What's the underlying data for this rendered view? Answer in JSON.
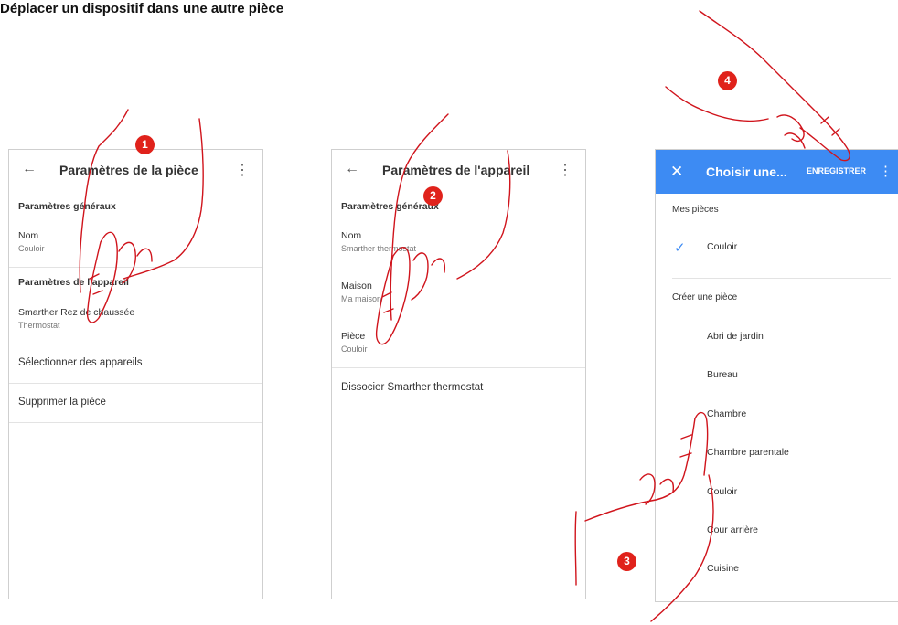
{
  "page": {
    "title": "Déplacer un dispositif dans une autre pièce"
  },
  "screen1": {
    "back_icon": "arrow-left-icon",
    "title": "Paramètres de la pièce",
    "general_section": "Paramètres généraux",
    "name_label": "Nom",
    "name_value": "Couloir",
    "device_section": "Paramètres de l'appareil",
    "device_name": "Smarther Rez de chaussée",
    "device_type": "Thermostat",
    "select_devices": "Sélectionner des appareils",
    "delete_room": "Supprimer la pièce"
  },
  "screen2": {
    "back_icon": "arrow-left-icon",
    "title": "Paramètres de l'appareil",
    "general_section": "Paramètres généraux",
    "name_label": "Nom",
    "name_value": "Smarther thermostat",
    "house_label": "Maison",
    "house_value": "Ma maison",
    "room_label": "Pièce",
    "room_value": "Couloir",
    "dissociate": "Dissocier Smarther thermostat"
  },
  "screen3": {
    "close_icon": "close-icon",
    "title": "Choisir une...",
    "save": "ENREGISTRER",
    "my_rooms": "Mes pièces",
    "selected_room": "Couloir",
    "create_room": "Créer une pièce",
    "rooms": [
      "Abri de jardin",
      "Bureau",
      "Chambre",
      "Chambre parentale",
      "Couloir",
      "Cour arrière",
      "Cuisine"
    ]
  },
  "steps": [
    "1",
    "2",
    "3",
    "4"
  ],
  "colors": {
    "accent": "#3d8bf3",
    "badge": "#e0221b",
    "hand_outline": "#d0141c"
  }
}
